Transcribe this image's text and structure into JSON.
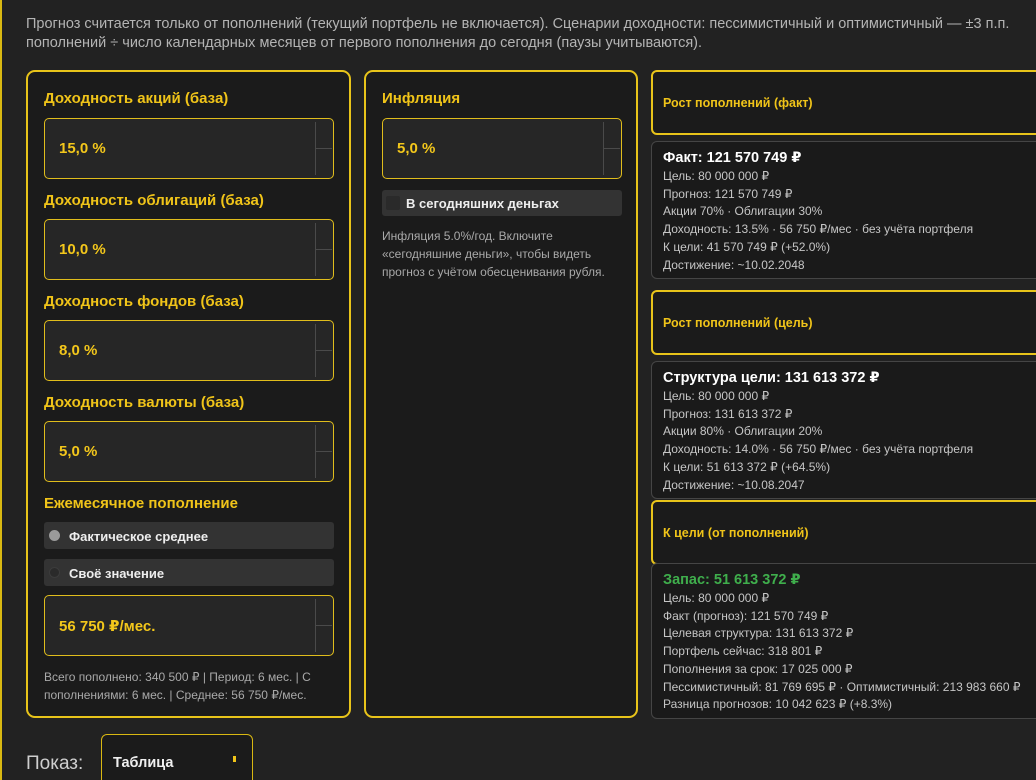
{
  "info_note": {
    "line1": "Прогноз считается только от пополнений (текущий портфель не включается). Сценарии доходности: пессимистичный и оптимистичный — ±3 п.п.",
    "line2": "пополнений ÷ число календарных месяцев от первого пополнения до сегодня (паузы учитываются)."
  },
  "returns": {
    "stocks_label": "Доходность акций (база)",
    "stocks_value": "15,0 %",
    "bonds_label": "Доходность облигаций (база)",
    "bonds_value": "10,0 %",
    "funds_label": "Доходность фондов (база)",
    "funds_value": "8,0 %",
    "currency_label": "Доходность валюты (база)",
    "currency_value": "5,0 %"
  },
  "contribution": {
    "label": "Ежемесячное пополнение",
    "options": [
      {
        "label": "Фактическое среднее",
        "selected": true
      },
      {
        "label": "Своё значение",
        "selected": false
      }
    ],
    "value": "56 750 ₽/мес.",
    "summary_line1": "Всего пополнено: 340 500 ₽ | Период: 6 мес. | С",
    "summary_line2": "пополнениями: 6 мес. | Среднее: 56 750 ₽/мес."
  },
  "inflation": {
    "label": "Инфляция",
    "value": "5,0 %",
    "todays_money_label": "В сегодняшних деньгах",
    "todays_money_checked": false,
    "hint_line1": "Инфляция 5.0%/год. Включите",
    "hint_line2": "«сегодняшние деньги», чтобы видеть",
    "hint_line3": "прогноз с учётом обесценивания рубля."
  },
  "cards": {
    "fact": {
      "title": "Рост пополнений (факт)",
      "head": "Факт: 121 570 749 ₽",
      "lines": [
        "Цель: 80 000 000 ₽",
        "Прогноз: 121 570 749 ₽",
        "Акции 70% · Облигации 30%",
        "Доходность: 13.5% · 56 750 ₽/мес · без учёта портфеля",
        "К цели: 41 570 749 ₽ (+52.0%)",
        "Достижение: ~10.02.2048"
      ]
    },
    "goal": {
      "title": "Рост пополнений (цель)",
      "head": "Структура цели: 131 613 372 ₽",
      "lines": [
        "Цель: 80 000 000 ₽",
        "Прогноз: 131 613 372 ₽",
        "Акции 80% · Облигации 20%",
        "Доходность: 14.0% · 56 750 ₽/мес · без учёта портфеля",
        "К цели: 51 613 372 ₽ (+64.5%)",
        "Достижение: ~10.08.2047"
      ]
    },
    "to_goal": {
      "title": "К цели (от пополнений)",
      "head": "Запас: 51 613 372 ₽",
      "head_color": "#3fae4c",
      "lines": [
        "Цель: 80 000 000 ₽",
        "Факт (прогноз): 121 570 749 ₽",
        "Целевая структура: 131 613 372 ₽",
        "Портфель сейчас: 318 801 ₽",
        "Пополнения за срок: 17 025 000 ₽",
        "Пессимистичный: 81 769 695 ₽ · Оптимистичный: 213 983 660 ₽",
        "Разница прогнозов: 10 042 623 ₽ (+8.3%)"
      ]
    }
  },
  "display": {
    "label": "Показ:",
    "selected": "Таблица"
  },
  "colors": {
    "accent": "#e8c41a",
    "background": "#222222",
    "panel": "#1b1b1b",
    "positive": "#3fae4c"
  }
}
